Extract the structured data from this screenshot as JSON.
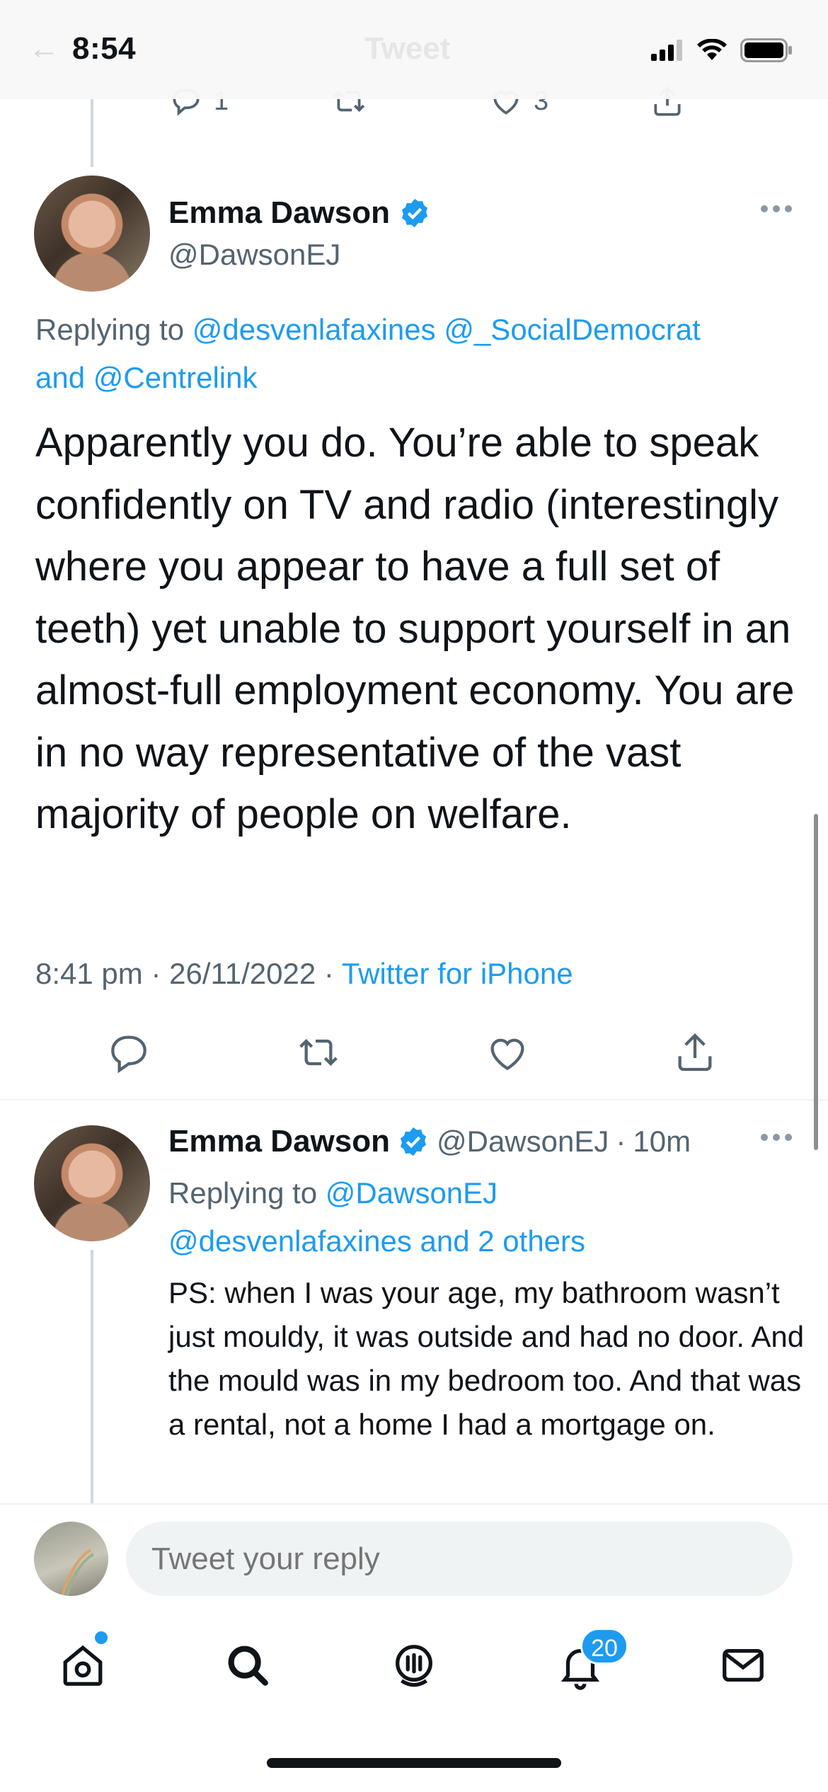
{
  "status_bar": {
    "time": "8:54"
  },
  "header": {
    "back_glyph": "←",
    "title": "Tweet"
  },
  "previous_tweet": {
    "reply_count": "1",
    "like_count": "3"
  },
  "main_tweet": {
    "author_name": "Emma Dawson",
    "author_handle": "@DawsonEJ",
    "replying_prefix": "Replying to ",
    "replying_user1": "@desvenlafaxines",
    "replying_user2": "@_SocialDemocrat",
    "replying_and": "and",
    "replying_user3": "@Centrelink",
    "text": "Apparently you do. You’re able to speak confidently on TV and radio (interestingly where you appear to have a full set of teeth) yet unable to support yourself in an almost-full employment economy. You are in no way representative of the vast majority of people on welfare.",
    "time": "8:41 pm",
    "date": "26/11/2022",
    "source": "Twitter for iPhone",
    "dot": "·"
  },
  "reply_tweet": {
    "author_name": "Emma Dawson",
    "author_handle": "@DawsonEJ",
    "age": "10m",
    "replying_prefix": "Replying to ",
    "replying_user1": "@DawsonEJ",
    "replying_user2": "@desvenlafaxines",
    "replying_others": "and 2 others",
    "text": "PS: when I was your age, my bathroom wasn’t just mouldy, it was outside and had no door. And the mould was in my bedroom too. And that was a rental, not a home I had a mortgage on."
  },
  "compose": {
    "placeholder": "Tweet your reply"
  },
  "tabbar": {
    "notifications_badge": "20"
  },
  "colors": {
    "accent": "#1d9bf0",
    "text": "#0f1419",
    "muted": "#536471"
  },
  "icons": [
    "reply-icon",
    "retweet-icon",
    "like-icon",
    "share-icon",
    "more-icon",
    "verified-icon",
    "home-icon",
    "search-icon",
    "spaces-icon",
    "notifications-icon",
    "messages-icon"
  ]
}
